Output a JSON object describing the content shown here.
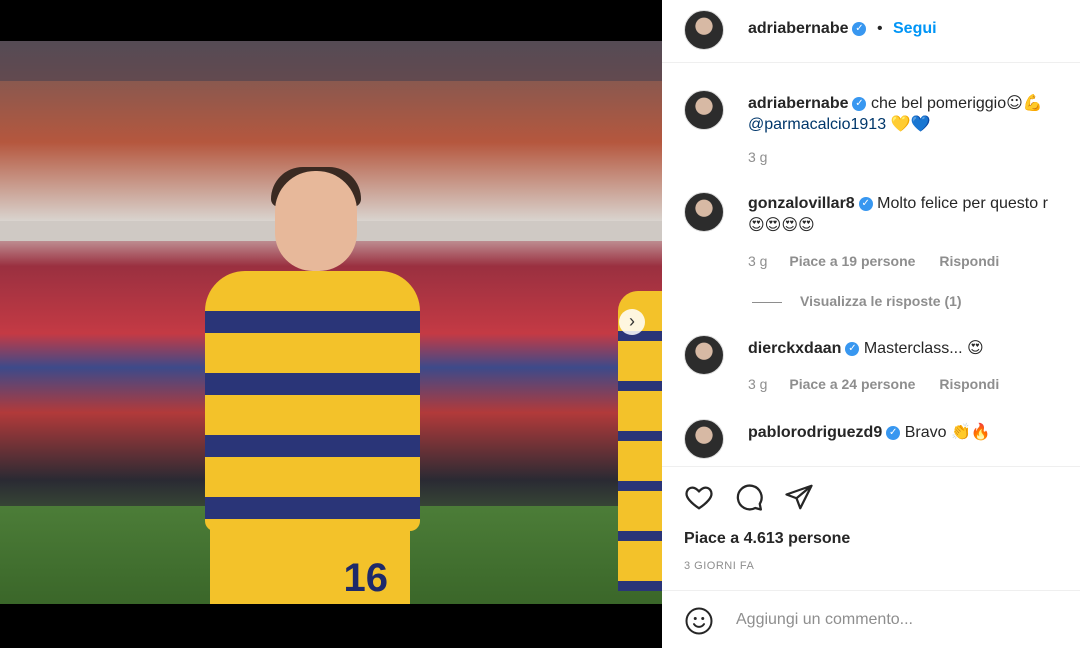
{
  "header": {
    "username": "adriabernabe",
    "follow_label": "Segui"
  },
  "caption": {
    "username": "adriabernabe",
    "text": "che bel pomeriggio",
    "emoji": "☺💪",
    "mention": "@parmacalcio1913",
    "hearts": "💛💙",
    "time": "3 g"
  },
  "comments": [
    {
      "username": "gonzalovillar8",
      "text": "Molto felice per questo r",
      "emoji": "😍😍😍😍",
      "time": "3 g",
      "likes": "Piace a 19 persone",
      "reply": "Rispondi",
      "view_replies": "Visualizza le risposte (1)"
    },
    {
      "username": "dierckxdaan",
      "text": "Masterclass...",
      "emoji": "😍",
      "time": "3 g",
      "likes": "Piace a 24 persone",
      "reply": "Rispondi"
    },
    {
      "username": "pablorodriguezd9",
      "text": "Bravo",
      "emoji": "👏🔥"
    }
  ],
  "actions": {
    "like_icon": "heart-icon",
    "comment_icon": "comment-icon",
    "share_icon": "share-icon"
  },
  "post": {
    "likes": "Piace a 4.613 persone",
    "ago": "3 GIORNI FA"
  },
  "composer": {
    "placeholder": "Aggiungi un commento...",
    "emoji_icon": "smiley-icon"
  },
  "media": {
    "jersey_number": "16",
    "carousel_count": 4,
    "carousel_active": 0
  },
  "colors": {
    "accent": "#0095f6",
    "verified": "#3897f0"
  }
}
